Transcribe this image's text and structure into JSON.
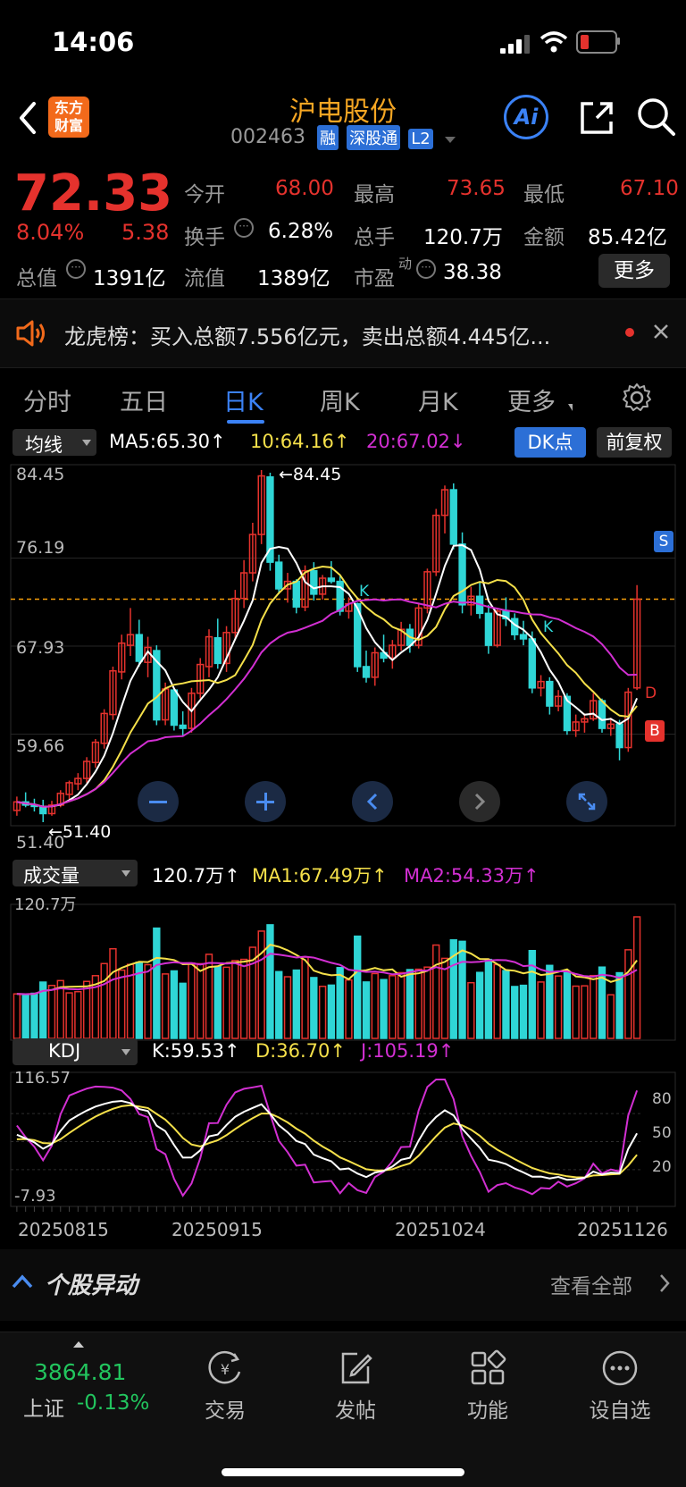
{
  "status": {
    "time": "14:06"
  },
  "header": {
    "logo": "东方\n财富",
    "title": "沪电股份",
    "code": "002463",
    "badges": [
      "融",
      "深股通",
      "L2"
    ],
    "ai_label": "Ai"
  },
  "quote": {
    "price": "72.33",
    "change_pct": "8.04%",
    "change": "5.38",
    "fields": {
      "open_label": "今开",
      "open": "68.00",
      "high_label": "最高",
      "high": "73.65",
      "low_label": "最低",
      "low": "67.10",
      "turnover_label": "换手",
      "turnover": "6.28%",
      "volume_label": "总手",
      "volume": "120.7万",
      "amount_label": "金额",
      "amount": "85.42亿",
      "mcap_label": "总值",
      "mcap": "1391亿",
      "float_label": "流值",
      "float": "1389亿",
      "pe_label": "市盈",
      "pe_sup": "动",
      "pe": "38.38",
      "more_label": "更多"
    }
  },
  "notice": {
    "text": "龙虎榜：买入总额7.556亿元，卖出总额4.445亿..."
  },
  "tabs": {
    "items": [
      "分时",
      "五日",
      "日K",
      "周K",
      "月K",
      "更多"
    ],
    "active": "日K"
  },
  "ma_bar": {
    "selector": "均线",
    "ma5": "MA5:65.30↑",
    "ma10": "10:64.16↑",
    "ma20": "20:67.02↓",
    "dk_label": "DK点",
    "adjust_label": "前复权"
  },
  "price_axis": {
    "labels": [
      "84.45",
      "76.19",
      "67.93",
      "59.66",
      "51.40"
    ]
  },
  "annotations": {
    "high": "←84.45",
    "low": "←51.40",
    "k1": "K",
    "k2": "K",
    "s": "S",
    "b": "B",
    "d": "D"
  },
  "volume_bar": {
    "selector": "成交量",
    "vol": "120.7万↑",
    "ma1": "MA1:67.49万↑",
    "ma2": "MA2:54.33万↑",
    "axis_top": "120.7万"
  },
  "kdj_bar": {
    "selector": "KDJ",
    "k": "K:59.53↑",
    "d": "D:36.70↑",
    "j": "J:105.19↑",
    "axis_top": "116.57",
    "axis_bottom": "-7.93",
    "levels": [
      "80",
      "50",
      "20"
    ]
  },
  "dates": [
    "20250815",
    "20250915",
    "20251024",
    "20251126"
  ],
  "movers": {
    "title": "个股异动",
    "view_all": "查看全部"
  },
  "bottom_nav": {
    "index_value": "3864.81",
    "index_name": "上证",
    "index_change": "-0.13%",
    "items": [
      "交易",
      "发帖",
      "功能",
      "设自选"
    ]
  },
  "colors": {
    "up": "#e5322d",
    "down": "#2fd6d6",
    "ma5": "#ffffff",
    "ma10": "#f5e04a",
    "ma20": "#d22fd2",
    "accent": "#3b82f6",
    "orange": "#f59e0b"
  },
  "chart_data": {
    "type": "candlestick",
    "ylim": [
      51.4,
      84.45
    ],
    "candles": [
      [
        52.5,
        53.8,
        52.0,
        53.3
      ],
      [
        53.3,
        54.2,
        52.8,
        53.0
      ],
      [
        53.0,
        53.6,
        52.4,
        52.9
      ],
      [
        52.8,
        53.5,
        51.4,
        52.2
      ],
      [
        52.2,
        53.4,
        52.0,
        53.0
      ],
      [
        53.0,
        54.4,
        52.8,
        54.1
      ],
      [
        54.0,
        55.3,
        53.5,
        55.1
      ],
      [
        55.0,
        56.0,
        54.4,
        55.5
      ],
      [
        55.5,
        57.5,
        55.1,
        57.1
      ],
      [
        57.0,
        59.2,
        56.5,
        58.9
      ],
      [
        58.8,
        62.0,
        58.3,
        61.6
      ],
      [
        61.5,
        66.0,
        61.0,
        65.6
      ],
      [
        65.5,
        69.0,
        64.8,
        68.2
      ],
      [
        68.0,
        71.5,
        67.0,
        69.0
      ],
      [
        69.0,
        70.4,
        66.0,
        66.5
      ],
      [
        66.4,
        68.8,
        65.0,
        67.8
      ],
      [
        67.5,
        68.0,
        60.5,
        61.0
      ],
      [
        61.0,
        64.5,
        60.5,
        63.9
      ],
      [
        63.8,
        64.0,
        60.0,
        60.5
      ],
      [
        60.5,
        61.8,
        59.5,
        60.2
      ],
      [
        60.2,
        64.0,
        59.8,
        63.5
      ],
      [
        63.5,
        66.8,
        63.0,
        66.2
      ],
      [
        66.0,
        69.5,
        65.0,
        68.8
      ],
      [
        68.7,
        70.5,
        65.8,
        66.3
      ],
      [
        66.3,
        69.8,
        65.5,
        69.2
      ],
      [
        69.2,
        73.2,
        68.5,
        72.4
      ],
      [
        72.4,
        76.0,
        71.5,
        74.8
      ],
      [
        74.8,
        79.5,
        74.0,
        78.4
      ],
      [
        78.4,
        84.45,
        77.5,
        83.9
      ],
      [
        83.8,
        84.2,
        75.0,
        75.8
      ],
      [
        75.8,
        76.5,
        72.8,
        73.3
      ],
      [
        73.3,
        74.8,
        72.0,
        74.0
      ],
      [
        74.0,
        74.2,
        71.0,
        71.6
      ],
      [
        71.6,
        75.5,
        71.2,
        75.0
      ],
      [
        75.0,
        75.8,
        72.2,
        72.8
      ],
      [
        72.8,
        74.6,
        72.3,
        74.3
      ],
      [
        74.3,
        75.9,
        73.8,
        74.0
      ],
      [
        74.0,
        74.5,
        70.8,
        71.2
      ],
      [
        71.2,
        72.5,
        70.5,
        71.9
      ],
      [
        71.9,
        72.0,
        65.5,
        66.0
      ],
      [
        66.0,
        67.5,
        64.5,
        65.0
      ],
      [
        65.0,
        67.8,
        64.2,
        67.3
      ],
      [
        67.3,
        69.0,
        66.4,
        66.8
      ],
      [
        66.8,
        68.5,
        65.8,
        68.0
      ],
      [
        68.0,
        70.2,
        67.5,
        69.5
      ],
      [
        69.5,
        70.0,
        67.3,
        68.0
      ],
      [
        68.0,
        72.0,
        67.7,
        71.5
      ],
      [
        71.5,
        75.2,
        71.0,
        74.9
      ],
      [
        74.9,
        80.8,
        74.5,
        80.2
      ],
      [
        80.2,
        83.0,
        78.5,
        82.6
      ],
      [
        82.6,
        83.2,
        77.0,
        77.5
      ],
      [
        77.5,
        78.6,
        71.0,
        71.8
      ],
      [
        71.8,
        73.5,
        70.8,
        72.6
      ],
      [
        72.6,
        74.0,
        70.5,
        71.0
      ],
      [
        71.0,
        71.8,
        67.2,
        68.0
      ],
      [
        68.0,
        71.5,
        67.8,
        71.2
      ],
      [
        71.2,
        72.5,
        69.8,
        70.5
      ],
      [
        70.5,
        71.0,
        68.5,
        69.0
      ],
      [
        69.0,
        70.3,
        68.0,
        68.6
      ],
      [
        68.6,
        69.3,
        63.5,
        64.0
      ],
      [
        64.0,
        65.2,
        63.2,
        64.6
      ],
      [
        64.6,
        65.0,
        61.5,
        62.3
      ],
      [
        62.3,
        63.8,
        61.8,
        63.2
      ],
      [
        63.2,
        63.5,
        59.6,
        60.0
      ],
      [
        60.0,
        61.5,
        59.4,
        60.8
      ],
      [
        60.8,
        61.6,
        59.8,
        61.1
      ],
      [
        61.1,
        63.5,
        60.9,
        62.8
      ],
      [
        62.8,
        63.0,
        59.8,
        60.2
      ],
      [
        60.2,
        61.2,
        59.5,
        60.6
      ],
      [
        60.6,
        61.0,
        57.2,
        58.4
      ],
      [
        58.4,
        64.0,
        58.0,
        63.6
      ],
      [
        64.0,
        73.65,
        63.8,
        72.33
      ]
    ],
    "volume_max": 120.7
  }
}
